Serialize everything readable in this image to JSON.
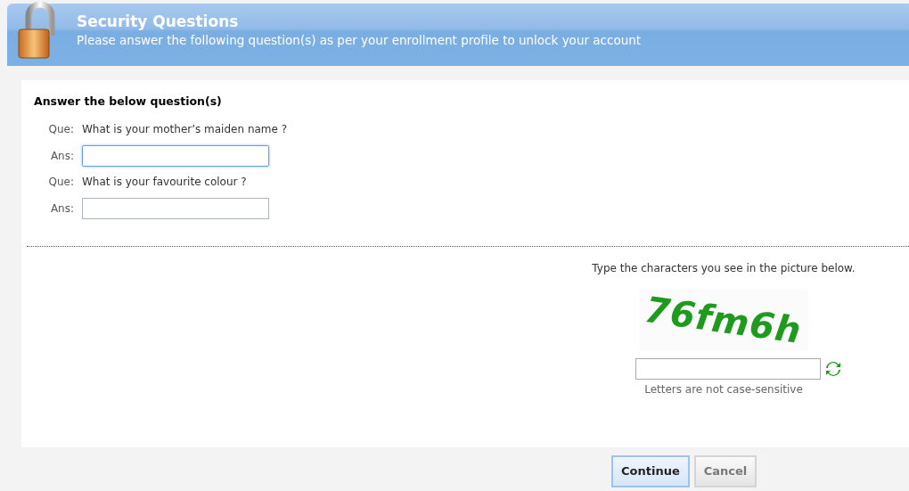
{
  "header": {
    "title": "Security Questions",
    "subtitle": "Please answer the following question(s) as per your enrollment profile to unlock your account"
  },
  "form": {
    "heading": "Answer the below question(s)",
    "questions": [
      {
        "que_label": "Que:",
        "question": "What is your mother’s maiden name ?",
        "ans_label": "Ans:",
        "focused": true
      },
      {
        "que_label": "Que:",
        "question": "What is your favourite colour ?",
        "ans_label": "Ans:",
        "focused": false
      }
    ]
  },
  "captcha": {
    "instruction": "Type the characters you see in the picture below.",
    "captcha_text": "76fm6h",
    "note": "Letters are not case-sensitive"
  },
  "buttons": [
    {
      "label": "Continue",
      "kind": "primary"
    },
    {
      "label": "Cancel",
      "kind": "secondary"
    }
  ]
}
